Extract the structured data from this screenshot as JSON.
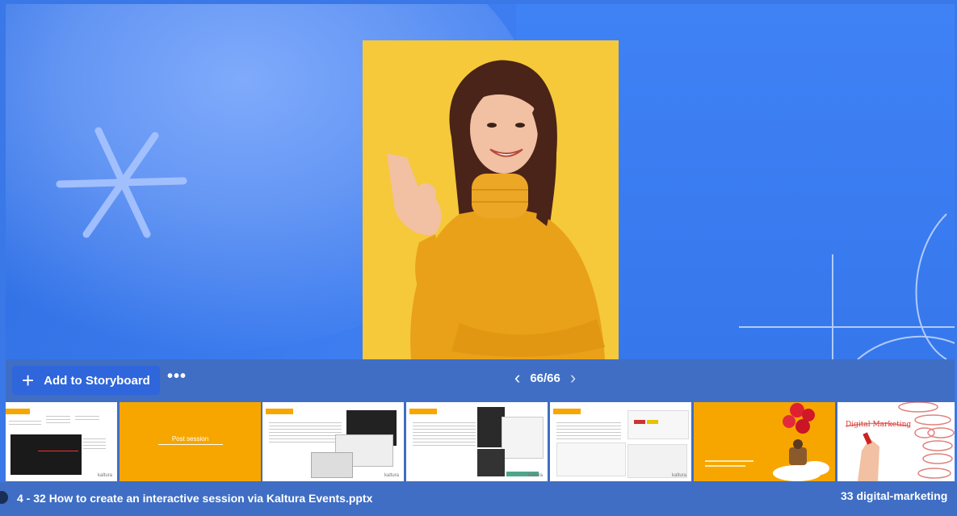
{
  "toolbar": {
    "add_label": "Add to Storyboard",
    "more_label": "•••",
    "prev_icon": "chevron-left-icon",
    "next_icon": "chevron-right-icon",
    "page_counter": "66/66"
  },
  "thumbnails": [
    {
      "type": "slide-screenshots"
    },
    {
      "type": "title",
      "text": "Post session"
    },
    {
      "type": "slide-screenshots"
    },
    {
      "type": "slide-screenshots"
    },
    {
      "type": "slide-screenshots"
    },
    {
      "type": "balloon-image"
    },
    {
      "type": "digital-marketing-image"
    }
  ],
  "bottom": {
    "left_title": "4 - 32 How to create an interactive session via Kaltura Events.pptx",
    "right_title": "33 digital-marketing"
  },
  "colors": {
    "slide_bg": "#3a78e8",
    "photo_bg": "#f6c93a",
    "toolbar_bg": "#3f6ec4",
    "button_bg": "#2f66dc",
    "thumb_orange": "#f7a600"
  }
}
